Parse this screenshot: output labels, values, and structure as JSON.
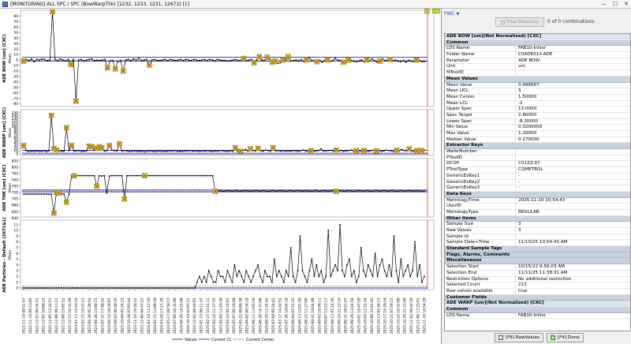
{
  "window": {
    "title": "[MONITORING] ALL SPC / SPC (BowWarpThk) [1232, 1233, 1231, 12671] [1]",
    "minimize_glyph": "—",
    "maximize_glyph": "☐",
    "close_glyph": "✕"
  },
  "filter": {
    "dropdown_label": "FWC",
    "dropdown_arrow": "▼",
    "button_label": "Filter Matching",
    "combinations": "0 of 0 combinations"
  },
  "charts": {
    "panels": [
      {
        "ylabel": "ADE BOW [um] (CXC)",
        "axis_name": "Mean"
      },
      {
        "ylabel": "ADE WARP [um] (CXC)",
        "axis_name": "Mean"
      },
      {
        "ylabel": "ADE THK [um] (CXC)",
        "axis_name": "Mean"
      },
      {
        "ylabel": "ADE Particles - Default (2671&1)",
        "axis_name": "Mean"
      }
    ],
    "legend": {
      "values": "Values",
      "current_cl": "Current CL",
      "current_center": "Current Center"
    }
  },
  "chart_data": [
    {
      "type": "line",
      "ylabel": "ADE BOW [um] (CXC)",
      "yticks": [
        "80",
        "70",
        "60",
        "50",
        "40",
        "30",
        "20",
        "10",
        "0",
        "-10",
        "-20",
        "-30",
        "-40",
        "-50",
        "-60",
        "-70",
        "-80"
      ],
      "ylim": [
        -82,
        88
      ],
      "center": 0,
      "ucl": 5,
      "lcl": -2,
      "values": [
        -2,
        1,
        -1,
        2,
        -3,
        1,
        0,
        2,
        1,
        -1,
        0,
        88,
        1,
        -1,
        2,
        0,
        -2,
        1,
        -8,
        1,
        -75,
        0,
        1,
        -2,
        0,
        1,
        2,
        -1,
        0,
        -1,
        0,
        1,
        -14,
        -2,
        -1,
        -16,
        -3,
        -1,
        -20,
        0,
        1,
        -1,
        2,
        0,
        3,
        -1,
        0,
        1,
        -9,
        0,
        1,
        -1,
        -1,
        0,
        1,
        -1,
        1,
        0,
        -1,
        0,
        1,
        -1,
        1,
        0,
        -1,
        1,
        0,
        -1,
        0,
        1,
        -1,
        1,
        0,
        -2,
        1,
        0,
        -1,
        -1,
        -2,
        -1,
        0,
        1,
        -1,
        0,
        3,
        -1,
        0,
        1,
        -5,
        0,
        6,
        0,
        -1,
        5,
        2,
        -4,
        -2,
        -6,
        -5,
        0,
        -1,
        6,
        -2,
        -1,
        0,
        -2,
        1,
        -3,
        0,
        5,
        -1,
        -2,
        -3,
        -1,
        -4,
        -1,
        0,
        -2,
        -1,
        3,
        0,
        -1,
        -4,
        -5,
        0,
        -1,
        -2,
        -3,
        -2,
        0,
        -3,
        0,
        -1,
        2,
        -1,
        -4,
        -2,
        2,
        -1,
        0,
        1,
        -1,
        0,
        -2,
        -3,
        -1,
        -4,
        -1,
        -2,
        -3,
        0,
        -1,
        -3,
        -3
      ],
      "flagged": [
        0,
        11,
        18,
        20,
        32,
        35,
        38,
        48,
        84,
        88,
        90,
        93,
        95,
        96,
        99,
        101,
        108,
        112,
        116,
        122,
        124,
        131,
        136,
        140,
        150,
        154,
        157,
        158
      ]
    },
    {
      "type": "line",
      "ylabel": "ADE WARP [um] (CXC)",
      "yticks": [
        "150",
        "140",
        "130",
        "120",
        "110",
        "100",
        "90",
        "80",
        "70",
        "60",
        "50",
        "40",
        "30",
        "20",
        "10",
        "0"
      ],
      "ylim": [
        0,
        155
      ],
      "center": 5,
      "ucl": 13,
      "lcl": 0,
      "values": [
        30,
        12,
        8,
        10,
        9,
        11,
        10,
        9,
        12,
        8,
        11,
        140,
        20,
        14,
        12,
        10,
        9,
        95,
        12,
        30,
        10,
        11,
        12,
        9,
        10,
        11,
        28,
        26,
        12,
        20,
        26,
        22,
        10,
        12,
        30,
        15,
        12,
        11,
        36,
        10,
        12,
        11,
        9,
        10,
        11,
        10,
        9,
        10,
        8,
        10,
        11,
        10,
        9,
        10,
        11,
        10,
        9,
        10,
        11,
        10,
        12,
        10,
        9,
        10,
        11,
        10,
        12,
        10,
        11,
        10,
        9,
        11,
        10,
        12,
        10,
        9,
        11,
        10,
        12,
        11,
        10,
        9,
        11,
        10,
        22,
        8,
        10,
        12,
        16,
        10,
        18,
        12,
        11,
        20,
        12,
        10,
        14,
        12,
        10,
        22,
        11,
        12,
        10,
        12,
        10,
        11,
        10,
        12,
        11,
        9,
        12,
        14,
        10,
        11,
        12,
        10,
        11,
        12,
        18,
        10,
        11,
        12,
        13,
        10,
        14,
        11,
        12,
        10,
        11,
        12,
        14,
        10,
        12,
        11,
        10,
        12,
        11,
        10,
        12,
        13,
        11,
        12,
        10,
        11,
        14,
        12,
        11,
        10,
        13,
        12,
        16,
        12,
        11,
        18,
        10,
        11,
        12,
        13,
        12,
        14
      ],
      "flagged": [
        0,
        11,
        12,
        13,
        17,
        19,
        26,
        27,
        29,
        30,
        31,
        34,
        38,
        84,
        86,
        90,
        93,
        99,
        114,
        124,
        132,
        135,
        140,
        148,
        153,
        156,
        158
      ]
    },
    {
      "type": "line",
      "ylabel": "ADE THK [um] (CXC)",
      "yticks": [
        "820",
        "800",
        "780",
        "760",
        "740",
        "720",
        "700",
        "680",
        "660",
        "640"
      ],
      "ylim": [
        648,
        822
      ],
      "center": 725,
      "ucl": 728,
      "lcl": 722,
      "values": [
        715,
        715,
        715,
        715,
        715,
        715,
        715,
        715,
        715,
        715,
        715,
        715,
        655,
        720,
        718,
        716,
        715,
        690,
        715,
        773,
        773,
        773,
        773,
        773,
        773,
        773,
        773,
        773,
        773,
        740,
        773,
        772,
        773,
        718,
        772,
        773,
        773,
        773,
        773,
        773,
        700,
        773,
        773,
        773,
        773,
        773,
        773,
        773,
        773,
        773,
        773,
        773,
        773,
        773,
        773,
        773,
        773,
        773,
        773,
        773,
        773,
        773,
        773,
        773,
        773,
        773,
        773,
        773,
        773,
        773,
        773,
        773,
        773,
        773,
        773,
        773,
        724,
        725,
        726,
        724,
        725,
        726,
        725,
        724,
        726,
        725,
        724,
        725,
        726,
        725,
        724,
        725,
        726,
        725,
        724,
        726,
        725,
        724,
        725,
        726,
        724,
        725,
        726,
        725,
        724,
        725,
        726,
        724,
        725,
        726,
        725,
        724,
        726,
        725,
        724,
        725,
        726,
        724,
        725,
        726,
        725,
        724,
        726,
        725,
        724,
        725,
        726,
        724,
        725,
        726,
        725,
        724,
        725,
        726,
        725,
        724,
        726,
        725,
        724,
        725,
        726,
        724,
        725,
        726,
        725,
        724,
        726,
        725,
        724,
        725,
        726,
        724,
        725,
        726,
        725,
        724,
        726,
        725,
        724,
        725
      ],
      "flagged": [
        12,
        13,
        14,
        17,
        20,
        29,
        40,
        48,
        76,
        124
      ]
    },
    {
      "type": "line",
      "ylabel": "ADE Particles - Default (2671&1)",
      "yticks": [
        "11",
        "10",
        "9",
        "8",
        "7",
        "6",
        "5",
        "4",
        "3",
        "2",
        "1",
        "0"
      ],
      "ylim": [
        0,
        11.5
      ],
      "center": 0.3,
      "ucl": 0,
      "lcl": 0,
      "values": [
        0,
        0,
        0,
        0,
        0,
        0,
        0,
        0,
        0,
        0,
        0,
        0,
        0,
        0,
        0,
        0,
        0,
        0,
        0,
        0,
        0,
        0,
        0,
        0,
        0,
        0,
        0,
        0,
        0,
        0,
        0,
        0,
        0,
        0,
        0,
        0,
        0,
        0,
        0,
        0,
        0,
        0,
        0,
        0,
        0,
        0,
        0,
        0,
        0,
        0,
        0,
        0,
        0,
        0,
        0,
        0,
        0,
        0,
        0,
        0,
        0,
        0,
        0,
        0,
        0,
        0,
        0,
        0,
        0,
        0,
        0,
        0,
        0,
        0,
        1,
        2,
        1,
        2,
        1,
        3,
        2,
        1,
        1,
        3,
        2,
        2,
        1,
        3,
        2,
        1,
        4,
        2,
        3,
        2,
        1,
        3,
        2,
        1,
        2,
        3,
        4,
        2,
        1,
        3,
        2,
        2,
        1,
        5,
        2,
        3,
        2,
        1,
        3,
        2,
        7,
        2,
        1,
        3,
        9,
        3,
        2,
        1,
        3,
        5,
        2,
        4,
        2,
        3,
        1,
        2,
        10,
        2,
        3,
        4,
        3,
        11,
        3,
        2,
        4,
        5,
        2,
        3,
        1,
        2,
        7,
        3,
        2,
        4,
        3,
        2,
        6,
        2,
        4,
        5,
        3,
        2,
        4,
        2,
        9,
        3,
        1,
        5,
        2,
        3,
        4,
        2,
        3,
        8,
        2,
        4,
        1,
        2
      ],
      "flagged": []
    }
  ],
  "x_labels": [
    "2022-11-18 08:51:47",
    "2022-11-18 09:13:05",
    "2022-12-05 09:54:51",
    "2022-12-05 10:06:22",
    "2022-12-05 13:32:51",
    "2022-12-06 09:11:21",
    "2022-12-09 15:02:52",
    "2022-12-15 16:32:49",
    "2023-01-13 15:16:19",
    "2023-02-25 10:25:21",
    "2023-04-30 05:26:54",
    "2023-06-26 15:08:15",
    "2023-07-31 17:48:32",
    "2023-08-18 18:29:07",
    "2023-09-05 06:28:35",
    "2023-10-08 05:54:23",
    "2023-10-26 07:03:44",
    "2023-11-10 19:58:42",
    "2023-12-08 04:47:23",
    "2024-01-18 11:47:16",
    "2024-02-21 11:09:58",
    "2024-03-26 17:21:38",
    "2024-05-17 09:50:57",
    "2024-07-08 16:31:00",
    "2024-08-20 14:55:08",
    "2024-10-19 02:05:21",
    "2024-12-02 08:18:03",
    "2025-01-23 06:11:37",
    "2025-02-27 10:41:11",
    "2025-03-16 11:37:55",
    "2025-04-04 12:20:38",
    "2025-04-24 04:14:03",
    "2025-05-07 06:19:08",
    "2025-05-22 09:00:38",
    "2025-06-02 08:54:18",
    "2025-06-11 13:05:58",
    "2025-06-20 14:57:06",
    "2025-06-29 11:54:42",
    "2025-07-08 05:54:42",
    "2025-07-17 14:42:52",
    "2025-07-26 18:04:18",
    "2025-08-04 07:51:32",
    "2025-08-13 12:01:26",
    "2025-08-22 11:27:00",
    "2025-08-31 18:04:49",
    "2025-09-03 10:56:11",
    "2025-09-07 13:22:13",
    "2025-09-12 07:24:36",
    "2025-09-16 21:22:33",
    "2025-09-21 16:51:47",
    "2025-09-26 13:44:58",
    "2025-10-01 18:47:28",
    "2025-10-04 11:52:34",
    "2025-10-08 21:01:45",
    "2025-10-13 05:36:53",
    "2025-10-17 14:29:54",
    "2025-10-21 07:59:21",
    "2025-10-25 18:32:06",
    "2025-10-29 21:53:49",
    "2025-11-02 09:44:58",
    "2025-11-06 17:25:01",
    "2025-11-10 10:54:29"
  ],
  "properties": {
    "title": "ADE BOW [um](Not Normalized) [CXC]",
    "rows": [
      {
        "type": "header",
        "k": "Common"
      },
      {
        "k": "LDS Name",
        "v": "FAB10-Inline"
      },
      {
        "k": "Folder Name",
        "v": "C0ADE01X-ADE"
      },
      {
        "k": "Parameter",
        "v": "ADE BOW"
      },
      {
        "k": "Unit",
        "v": "um"
      },
      {
        "k": "MToolID",
        "v": ""
      },
      {
        "type": "header",
        "k": "Mean Values"
      },
      {
        "k": "Mean Value",
        "v": "0.496667"
      },
      {
        "k": "Mean UCL",
        "v": "5"
      },
      {
        "k": "Mean Center",
        "v": "1.50000"
      },
      {
        "k": "Mean LCL",
        "v": "-2"
      },
      {
        "k": "Upper Spec",
        "v": "13.0000"
      },
      {
        "k": "Spec Target",
        "v": "2.80000"
      },
      {
        "k": "Lower Spec",
        "v": "-8.20000"
      },
      {
        "k": "Min Value",
        "v": "0.0200000"
      },
      {
        "k": "Max Value",
        "v": "1.20000"
      },
      {
        "k": "Median Value",
        "v": "0.270000"
      },
      {
        "type": "header",
        "k": "Extractor Keys"
      },
      {
        "k": "WaferNumber",
        "v": ""
      },
      {
        "k": "PToolID",
        "v": ""
      },
      {
        "k": "DCOP",
        "v": "C01ZZ:07"
      },
      {
        "k": "PToolType",
        "v": "CQMETROL"
      },
      {
        "k": "GenericExKey1",
        "v": "-"
      },
      {
        "k": "GenericExKey2",
        "v": "-"
      },
      {
        "k": "GenericExKey3",
        "v": "-"
      },
      {
        "type": "header",
        "k": "Data Keys"
      },
      {
        "k": "MetrologyTime",
        "v": "2025-11-10 10:54:43"
      },
      {
        "k": "UserID",
        "v": ""
      },
      {
        "k": "MetrologyType",
        "v": "REGULAR"
      },
      {
        "type": "header",
        "k": "Other Items"
      },
      {
        "k": "Sample Size",
        "v": "3"
      },
      {
        "k": "Raw Values",
        "v": "3"
      },
      {
        "k": "Sample Id",
        "v": ""
      },
      {
        "k": "Sample Date+Time",
        "v": "11/10/25 10:54:43 AM"
      },
      {
        "type": "header",
        "k": "Standard Sample Tags"
      },
      {
        "type": "header",
        "k": "Flags, Alarms, Comments"
      },
      {
        "type": "header",
        "k": "Miscellaneous"
      },
      {
        "k": "Selection Start",
        "v": "10/15/22 9:56:03 AM"
      },
      {
        "k": "Selection End",
        "v": "11/11/25 11:38:31 AM"
      },
      {
        "k": "Restriction Options",
        "v": "No additional restriction"
      },
      {
        "k": "Selected Count",
        "v": "213"
      },
      {
        "k": "Raw values available",
        "v": "true"
      },
      {
        "type": "header",
        "k": "Customer Fields"
      },
      {
        "type": "top",
        "k": "ADE WARP [um](Not Normalized) [CXC]"
      },
      {
        "type": "header",
        "k": "Common"
      },
      {
        "k": "LDS Name",
        "v": "FAB10-Inline"
      }
    ]
  },
  "footer": {
    "raw_values_label": "[F8] RawValues",
    "done_label": "[F4] Done"
  },
  "colors": {
    "values_line": "#000000",
    "cl_line": "#3a1fb0",
    "center_line": "#444444",
    "flag_fill": "#c8d84a",
    "flag_cross": "#d81e1e",
    "selection_line": "#d23a1a"
  }
}
